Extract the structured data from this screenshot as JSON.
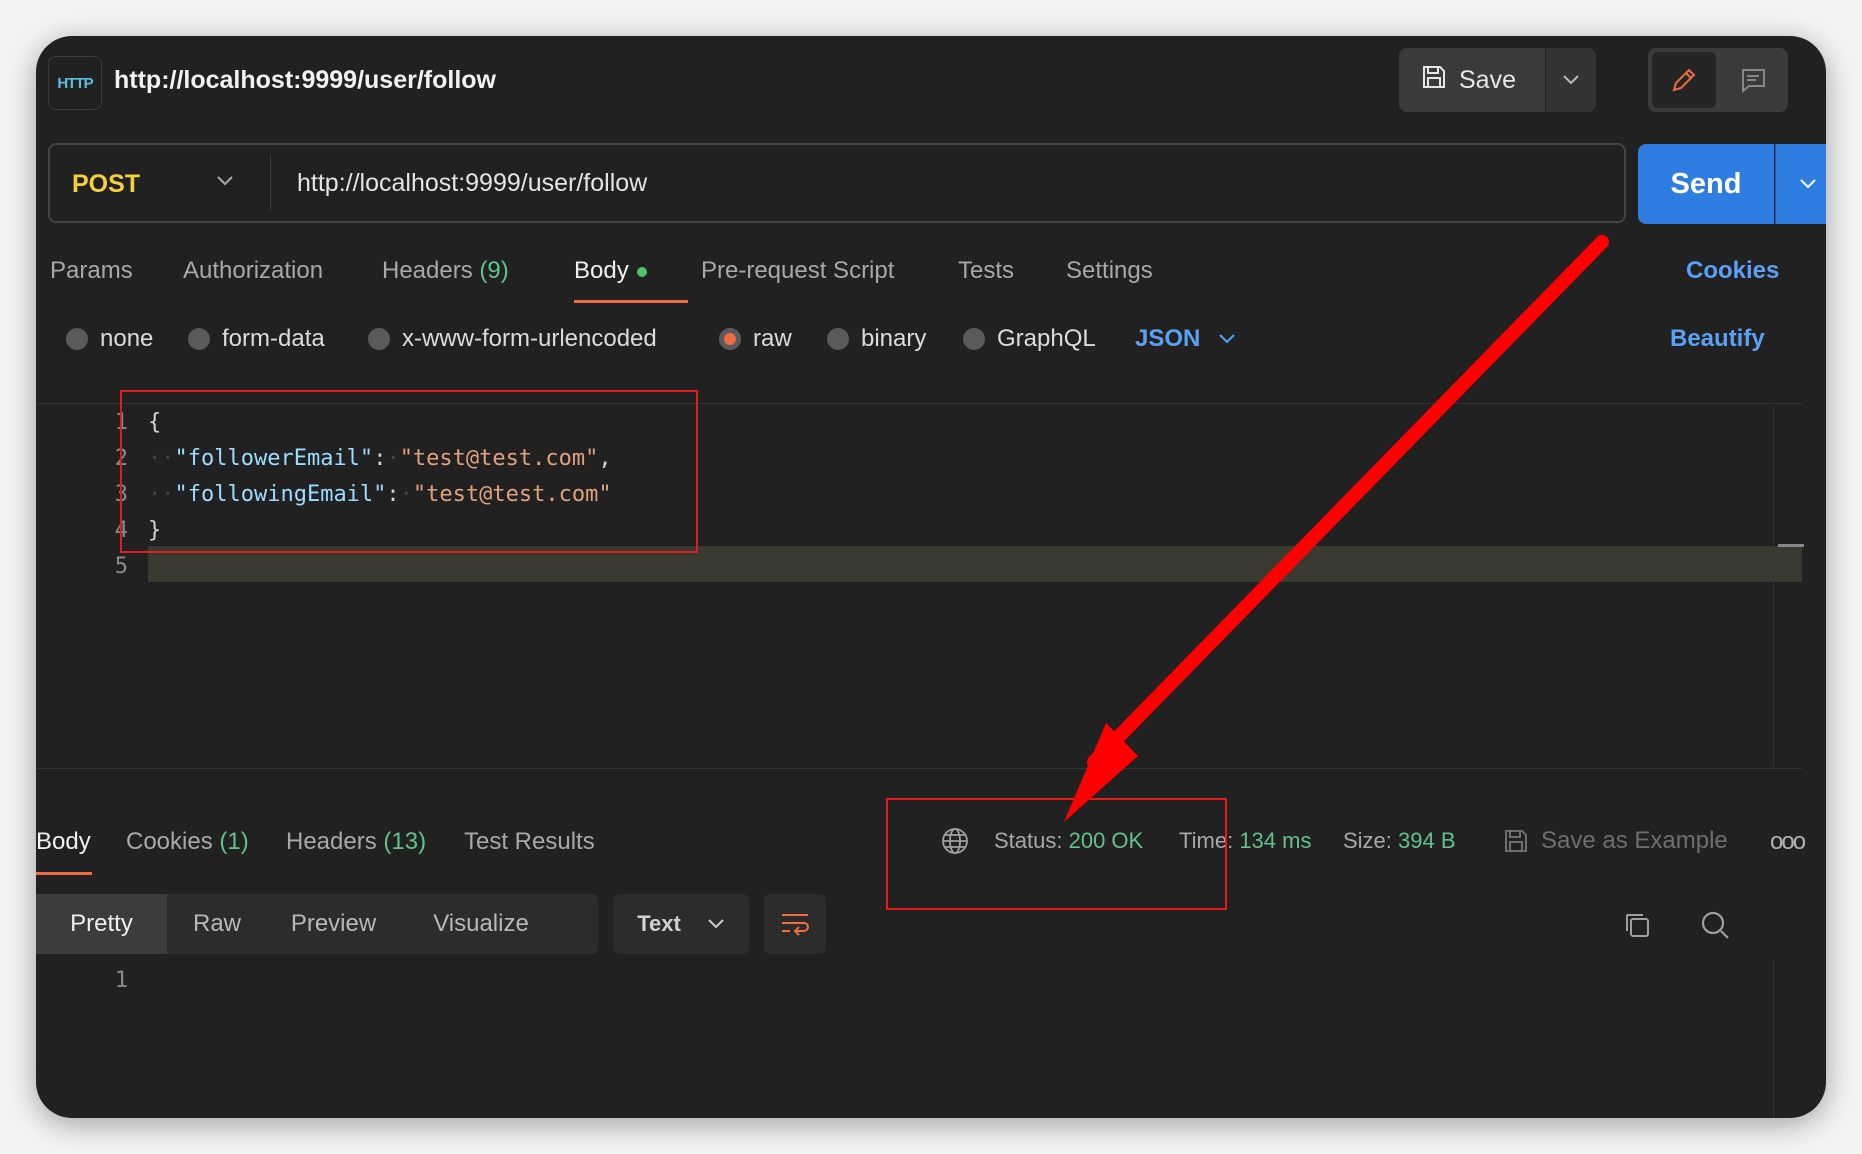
{
  "header": {
    "http_badge": "HTTP",
    "title": "http://localhost:9999/user/follow",
    "save_label": "Save"
  },
  "request": {
    "method": "POST",
    "url": "http://localhost:9999/user/follow",
    "send_label": "Send"
  },
  "tabs": [
    {
      "label": "Params",
      "count": ""
    },
    {
      "label": "Authorization",
      "count": ""
    },
    {
      "label": "Headers",
      "count": "(9)"
    },
    {
      "label": "Body",
      "count": ""
    },
    {
      "label": "Pre-request Script",
      "count": ""
    },
    {
      "label": "Tests",
      "count": ""
    },
    {
      "label": "Settings",
      "count": ""
    }
  ],
  "cookies_link": "Cookies",
  "body_types": [
    "none",
    "form-data",
    "x-www-form-urlencoded",
    "raw",
    "binary",
    "GraphQL"
  ],
  "body_type_selected": "raw",
  "format": "JSON",
  "beautify": "Beautify",
  "editor": {
    "line_numbers": [
      "1",
      "2",
      "3",
      "4",
      "5"
    ],
    "open_brace": "{",
    "line2_key": "\"followerEmail\"",
    "line2_value": "\"test@test.com\"",
    "line3_key": "\"followingEmail\"",
    "line3_value": "\"test@test.com\"",
    "close_brace": "}"
  },
  "response": {
    "tabs": [
      {
        "label": "Body",
        "count": ""
      },
      {
        "label": "Cookies",
        "count": "(1)"
      },
      {
        "label": "Headers",
        "count": "(13)"
      },
      {
        "label": "Test Results",
        "count": ""
      }
    ],
    "status_label": "Status:",
    "status_value": "200 OK",
    "time_label": "Time:",
    "time_value": "134 ms",
    "size_label": "Size:",
    "size_value": "394 B",
    "save_example": "Save as Example",
    "more": "ooo",
    "views": [
      "Pretty",
      "Raw",
      "Preview",
      "Visualize"
    ],
    "text_select": "Text",
    "line_numbers": [
      "1"
    ]
  },
  "colors": {
    "accent_orange": "#ef6c3f",
    "send_blue": "#2f7de1",
    "status_green": "#62c28a",
    "method_yellow": "#f4d03f",
    "annotation_red": "#e31b1b"
  }
}
